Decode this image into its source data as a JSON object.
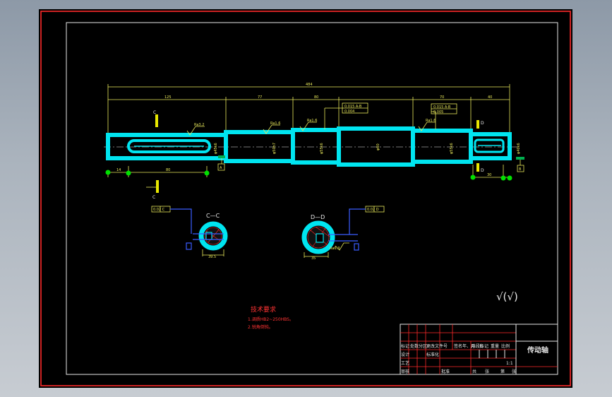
{
  "drawing": {
    "title": "传动轴",
    "tech_req": {
      "title": "技术要求",
      "lines": [
        "1.调质HB2~250HBS。",
        "2.锐角倒钝。"
      ]
    },
    "sections": {
      "c": {
        "label": "C—C",
        "marker": "C"
      },
      "d": {
        "label": "D—D",
        "marker": "D"
      }
    },
    "dimensions": {
      "overall": "484",
      "seg1": "125",
      "seg2": "77",
      "seg3": "80",
      "seg4": "70",
      "seg5": "40",
      "key_c": "80",
      "key_c_offset": "14",
      "key_d": "30"
    },
    "tolerances": {
      "left": [
        "0.015 A-B",
        "0.004"
      ],
      "right": [
        "0.015 A-B",
        "0.005"
      ],
      "datum_a": "A",
      "datum_b": "B",
      "sec_c": "0.02 C",
      "sec_d": "0.02 D"
    },
    "roughness": {
      "r1": "Ra3.2",
      "r2": "Ra1.6",
      "r3": "Ra1.6",
      "r4": "Ra1.6",
      "r5": "Ra3.2",
      "r6": "Ra6.3",
      "r7": "Ra3.2",
      "general": "√(√)"
    },
    "title_block": {
      "headers": [
        "标记",
        "处数",
        "分区",
        "更改文件号",
        "签名",
        "年、月、日"
      ],
      "row2": [
        "设计",
        "",
        "标准化",
        "",
        "阶段标记",
        "重量",
        "比例"
      ],
      "scale": "1:1",
      "row4": [
        "审核",
        "",
        "",
        "",
        "共",
        "张",
        "第",
        "张"
      ],
      "row5": [
        "工艺",
        "",
        "批准"
      ]
    }
  }
}
